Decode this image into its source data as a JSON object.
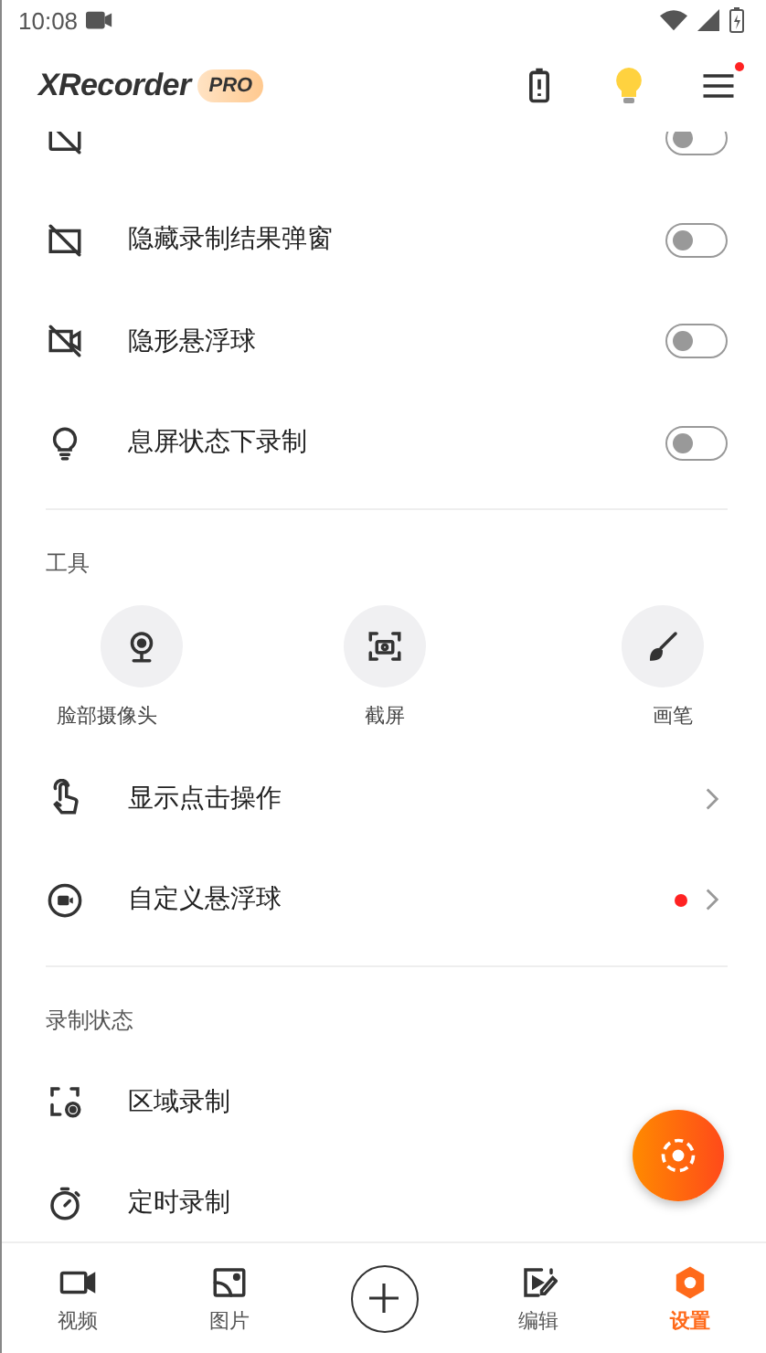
{
  "status_bar": {
    "time": "10:08"
  },
  "header": {
    "logo": "XRecorder",
    "badge": "PRO",
    "menu_dot": true
  },
  "sections": [
    {
      "items": [
        {
          "kind": "toggle",
          "on": false
        },
        {
          "kind": "toggle",
          "label": "隐藏录制结果弹窗",
          "on": false
        },
        {
          "kind": "toggle",
          "label": "隐形悬浮球",
          "on": false
        },
        {
          "kind": "toggle",
          "label": "息屏状态下录制",
          "on": false
        }
      ]
    },
    {
      "title": "工具",
      "tools": [
        {
          "label": "脸部摄像头"
        },
        {
          "label": "截屏"
        },
        {
          "label": "画笔"
        }
      ],
      "items": [
        {
          "kind": "nav",
          "label": "显示点击操作",
          "dot": false
        },
        {
          "kind": "nav",
          "label": "自定义悬浮球",
          "dot": true
        }
      ]
    },
    {
      "title": "录制状态",
      "items": [
        {
          "kind": "plain",
          "label": "区域录制"
        },
        {
          "kind": "plain",
          "label": "定时录制"
        }
      ]
    }
  ],
  "tabs": [
    {
      "kind": "tab",
      "label": "视频",
      "selected": false
    },
    {
      "kind": "tab",
      "label": "图片",
      "selected": false
    },
    {
      "kind": "add"
    },
    {
      "kind": "tab",
      "label": "编辑",
      "selected": false
    },
    {
      "kind": "tab",
      "label": "设置",
      "selected": true
    }
  ]
}
